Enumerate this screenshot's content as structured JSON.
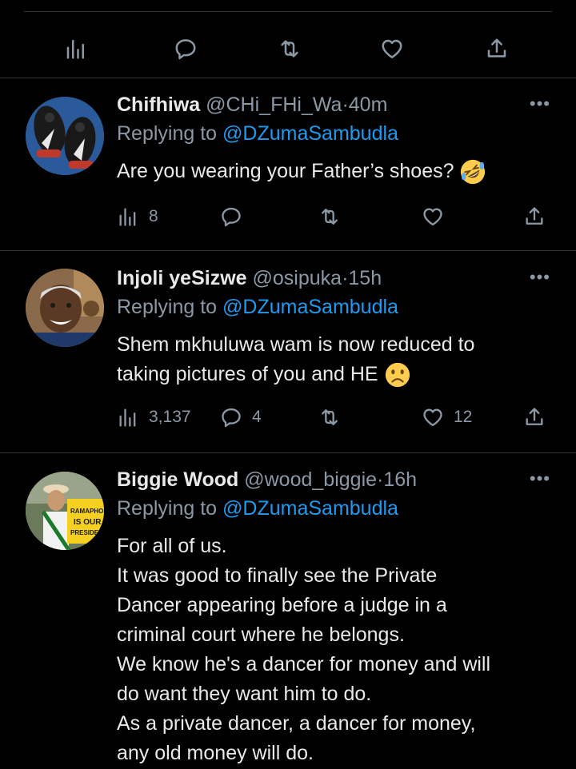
{
  "tweets": [
    {
      "name": "Chifhiwa",
      "handle": "@CHi_FHi_Wa",
      "dot": "·",
      "time": "40m",
      "replying_prefix": "Replying to ",
      "replying_to": "@DZumaSambudla",
      "body_lines": [
        "Are you wearing your Father’s shoes?"
      ],
      "emoji": "rolling-on-floor-laughing",
      "stats": {
        "views": "8",
        "replies": "",
        "retweets": "",
        "likes": ""
      }
    },
    {
      "name": "Injoli yeSizwe",
      "handle": "@osipuka",
      "dot": "·",
      "time": "15h",
      "replying_prefix": "Replying to ",
      "replying_to": "@DZumaSambudla",
      "body_lines": [
        "Shem mkhuluwa wam is now reduced to",
        "taking pictures of you and HE"
      ],
      "emoji": "frowning-face",
      "stats": {
        "views": "3,137",
        "replies": "4",
        "retweets": "",
        "likes": "12"
      }
    },
    {
      "name": "Biggie Wood",
      "handle": "@wood_biggie",
      "dot": "·",
      "time": "16h",
      "replying_prefix": "Replying to ",
      "replying_to": "@DZumaSambudla",
      "avatar_sign_text": [
        "RAMAPHOS",
        "IS OUR",
        "PRESIDE"
      ],
      "body_lines": [
        "For all of us.",
        "It was good to finally see the Private",
        "Dancer appearing before a judge in a",
        "criminal court where he belongs.",
        "We know he's a dancer for money and will",
        "do want they want him to do.",
        "As a private dancer, a dancer for money,",
        "any old money will do."
      ]
    }
  ],
  "more_label": "•••",
  "colors": {
    "background": "#000000",
    "text": "#e7e9ea",
    "muted": "#8b98a5",
    "link": "#1d9bf0",
    "divider": "#2f3336"
  }
}
